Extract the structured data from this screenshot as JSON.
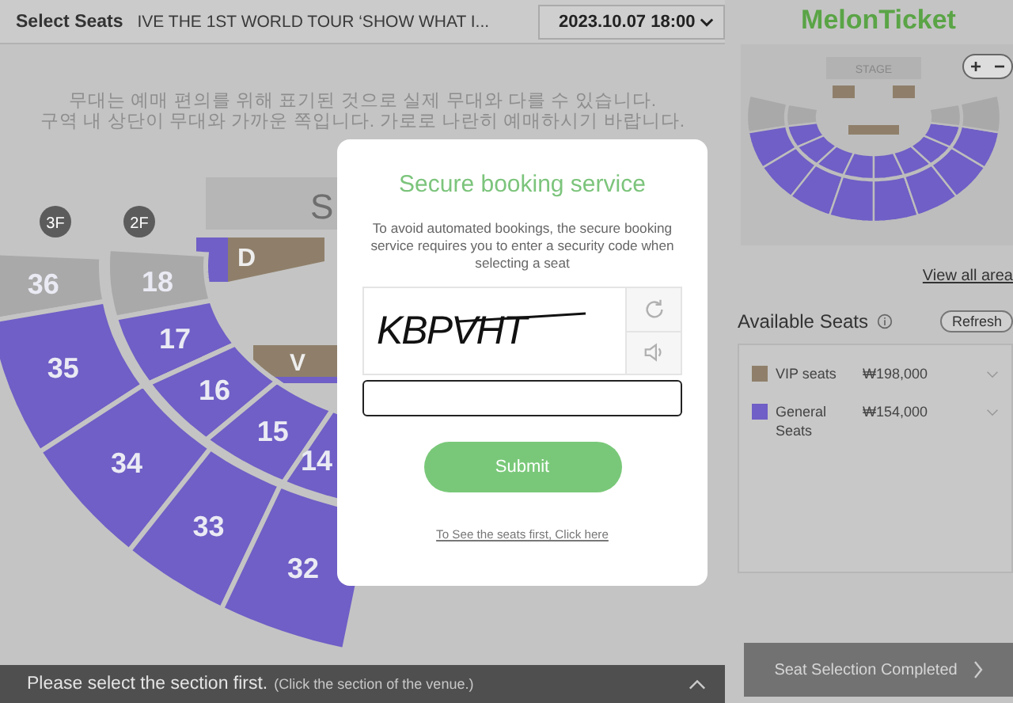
{
  "top_bar": {
    "title": "Select Seats",
    "event": "IVE THE 1ST WORLD TOUR ‘SHOW WHAT I...",
    "date_select": "2023.10.07 18:00"
  },
  "venue_map": {
    "notice": [
      "무대는 예매 편의를 위해 표기된 것으로 실제 무대와 다를 수 있습니다.",
      "구역 내 상단이 무대와 가까운 쪽입니다. 가로로 나란히 예매하시기 바랍니다."
    ],
    "floor_badges": [
      "3F",
      "2F"
    ],
    "stage_label": "S",
    "blocks": [
      {
        "label": "D",
        "kind": "side"
      },
      {
        "label": "V",
        "kind": "floor"
      }
    ],
    "outer_sections": [
      {
        "label": "36",
        "available": false
      },
      {
        "label": "35",
        "available": true
      },
      {
        "label": "34",
        "available": true
      },
      {
        "label": "33",
        "available": true
      },
      {
        "label": "32",
        "available": true
      }
    ],
    "inner_sections": [
      {
        "label": "18",
        "available": false
      },
      {
        "label": "17",
        "available": true
      },
      {
        "label": "16",
        "available": true
      },
      {
        "label": "15",
        "available": true
      },
      {
        "label": "14",
        "available": true
      }
    ]
  },
  "modal": {
    "title": "Secure booking service",
    "description": "To avoid automated bookings, the secure booking service requires you to enter a security code when selecting a seat",
    "captcha_text": "KBPVHT",
    "submit": "Submit",
    "link": "To See the seats first, Click here"
  },
  "status_bar": {
    "message": "Please select the section first.",
    "hint": "(Click the section of the venue.)"
  },
  "sidebar": {
    "logo": "MelonTicket",
    "minimap": {
      "stage_label": "STAGE",
      "zoom_in": "+",
      "zoom_out": "−"
    },
    "view_all": "View all area",
    "available_title": "Available Seats",
    "refresh": "Refresh",
    "grades": [
      {
        "name": "VIP seats",
        "price": "₩198,000",
        "color": "#8f7f6a"
      },
      {
        "name": "General Seats",
        "price": "₩154,000",
        "color": "#6f5fc6"
      }
    ],
    "complete_button": "Seat Selection Completed"
  }
}
